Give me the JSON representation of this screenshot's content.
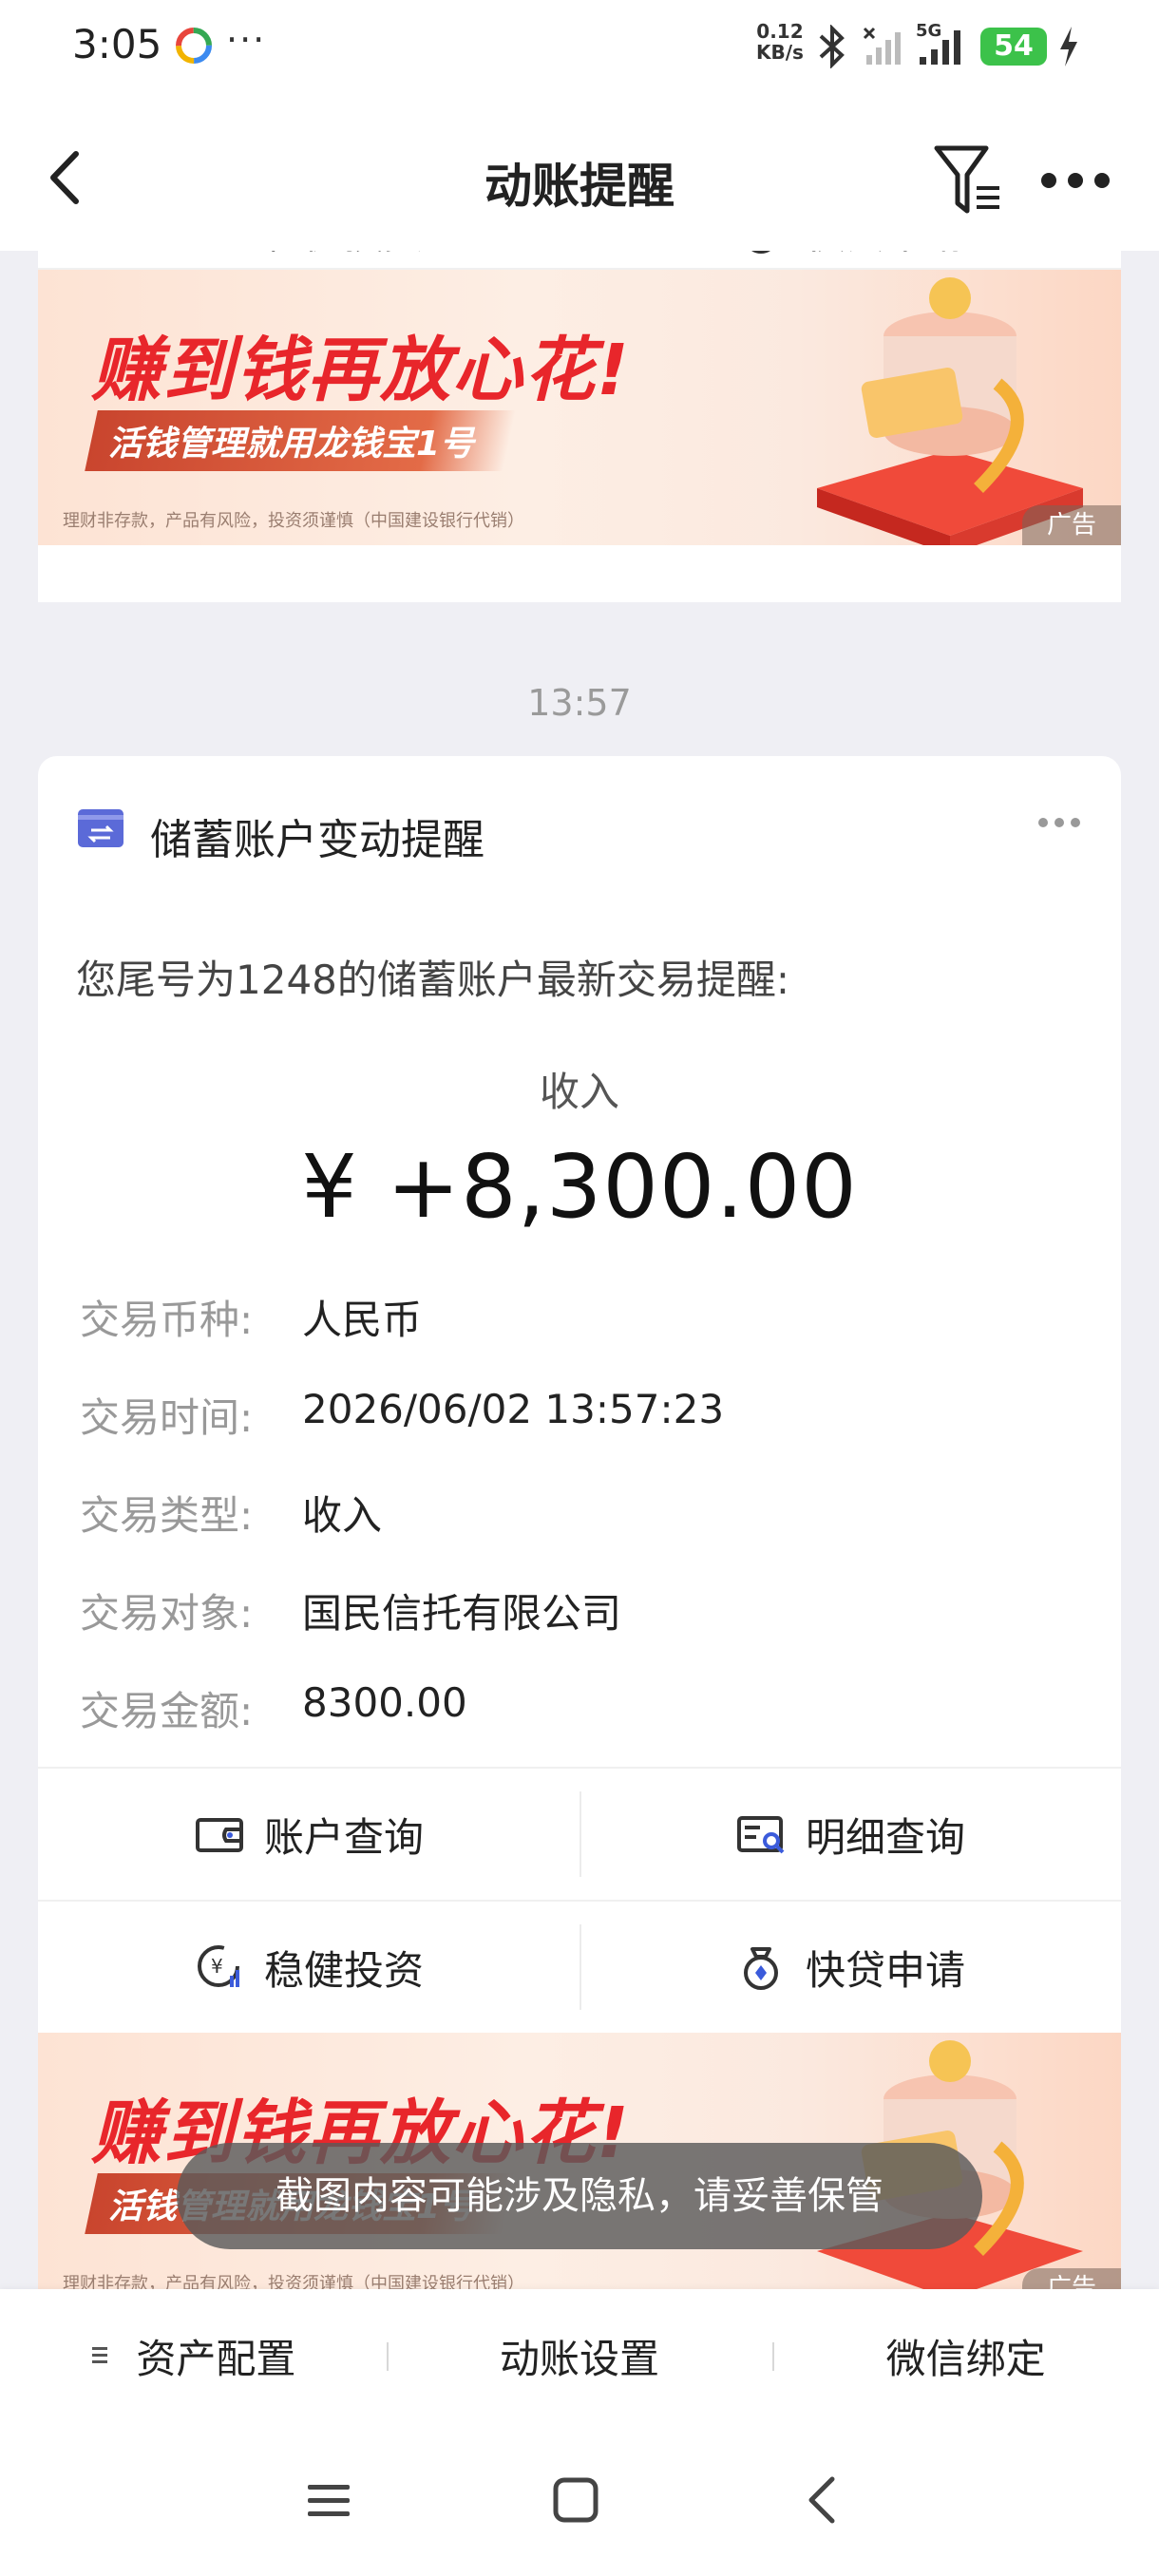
{
  "status_bar": {
    "time": "3:05",
    "dots": "···",
    "net_speed_value": "0.12",
    "net_speed_unit": "KB/s",
    "signal_label": "5G",
    "battery": "54"
  },
  "header": {
    "title": "动账提醒"
  },
  "top_card": {
    "actions": [
      {
        "label": "稳健投资",
        "icon": "invest-icon"
      },
      {
        "label": "快贷申请",
        "icon": "loan-icon"
      }
    ]
  },
  "ad": {
    "headline": "赚到钱再放心花!",
    "subline": "活钱管理就用龙钱宝1号",
    "disclaimer": "理财非存款，产品有风险，投资须谨慎（中国建设银行代销）",
    "tag": "广告"
  },
  "timestamp": "13:57",
  "notice_card": {
    "title": "储蓄账户变动提醒",
    "intro": "您尾号为1248的储蓄账户最新交易提醒:",
    "amount_type": "收入",
    "amount": "¥ +8,300.00",
    "details": [
      {
        "label": "交易币种:",
        "value": "人民币"
      },
      {
        "label": "交易时间:",
        "value": "2026/06/02 13:57:23"
      },
      {
        "label": "交易类型:",
        "value": "收入"
      },
      {
        "label": "交易对象:",
        "value": "国民信托有限公司"
      },
      {
        "label": "交易金额:",
        "value": "8300.00"
      }
    ],
    "actions_row1": [
      {
        "label": "账户查询",
        "icon": "wallet-icon"
      },
      {
        "label": "明细查询",
        "icon": "statement-search-icon"
      }
    ],
    "actions_row2": [
      {
        "label": "稳健投资",
        "icon": "invest-icon"
      },
      {
        "label": "快贷申请",
        "icon": "loan-icon"
      }
    ]
  },
  "toast": "截图内容可能涉及隐私，请妥善保管",
  "bottom_tabs": [
    {
      "label": "资产配置",
      "icon": "menu-lines-icon"
    },
    {
      "label": "动账设置"
    },
    {
      "label": "微信绑定"
    }
  ],
  "colors": {
    "ad_red": "#e8262b",
    "accent_blue": "#5b6ad8",
    "battery_green": "#3cc24a"
  }
}
